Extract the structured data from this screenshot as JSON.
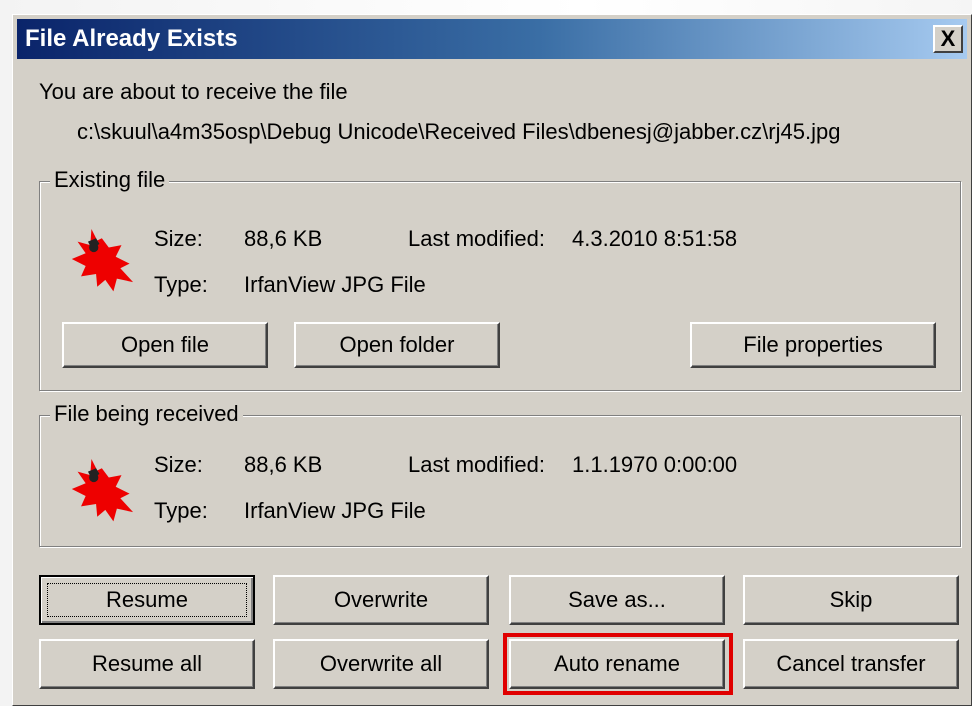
{
  "dialog": {
    "title": "File Already Exists",
    "close_label": "X",
    "intro": "You are about to receive the file",
    "file_path": "c:\\skuul\\a4m35osp\\Debug Unicode\\Received Files\\dbenesj@jabber.cz\\rj45.jpg"
  },
  "existing": {
    "legend": "Existing file",
    "size_label": "Size:",
    "size_value": "88,6 KB",
    "modified_label": "Last modified:",
    "modified_value": "4.3.2010 8:51:58",
    "type_label": "Type:",
    "type_value": "IrfanView JPG File",
    "icon": "irfanview-icon",
    "buttons": {
      "open_file": "Open file",
      "open_folder": "Open folder",
      "properties": "File properties"
    }
  },
  "received": {
    "legend": "File being received",
    "size_label": "Size:",
    "size_value": "88,6 KB",
    "modified_label": "Last modified:",
    "modified_value": "1.1.1970 0:00:00",
    "type_label": "Type:",
    "type_value": "IrfanView JPG File",
    "icon": "irfanview-icon"
  },
  "actions": {
    "resume": "Resume",
    "overwrite": "Overwrite",
    "save_as": "Save as...",
    "skip": "Skip",
    "resume_all": "Resume all",
    "overwrite_all": "Overwrite all",
    "auto_rename": "Auto rename",
    "cancel_transfer": "Cancel transfer"
  },
  "colors": {
    "highlight": "#e00000",
    "icon": "#ee0000",
    "dialog_bg": "#d4d0c8"
  }
}
